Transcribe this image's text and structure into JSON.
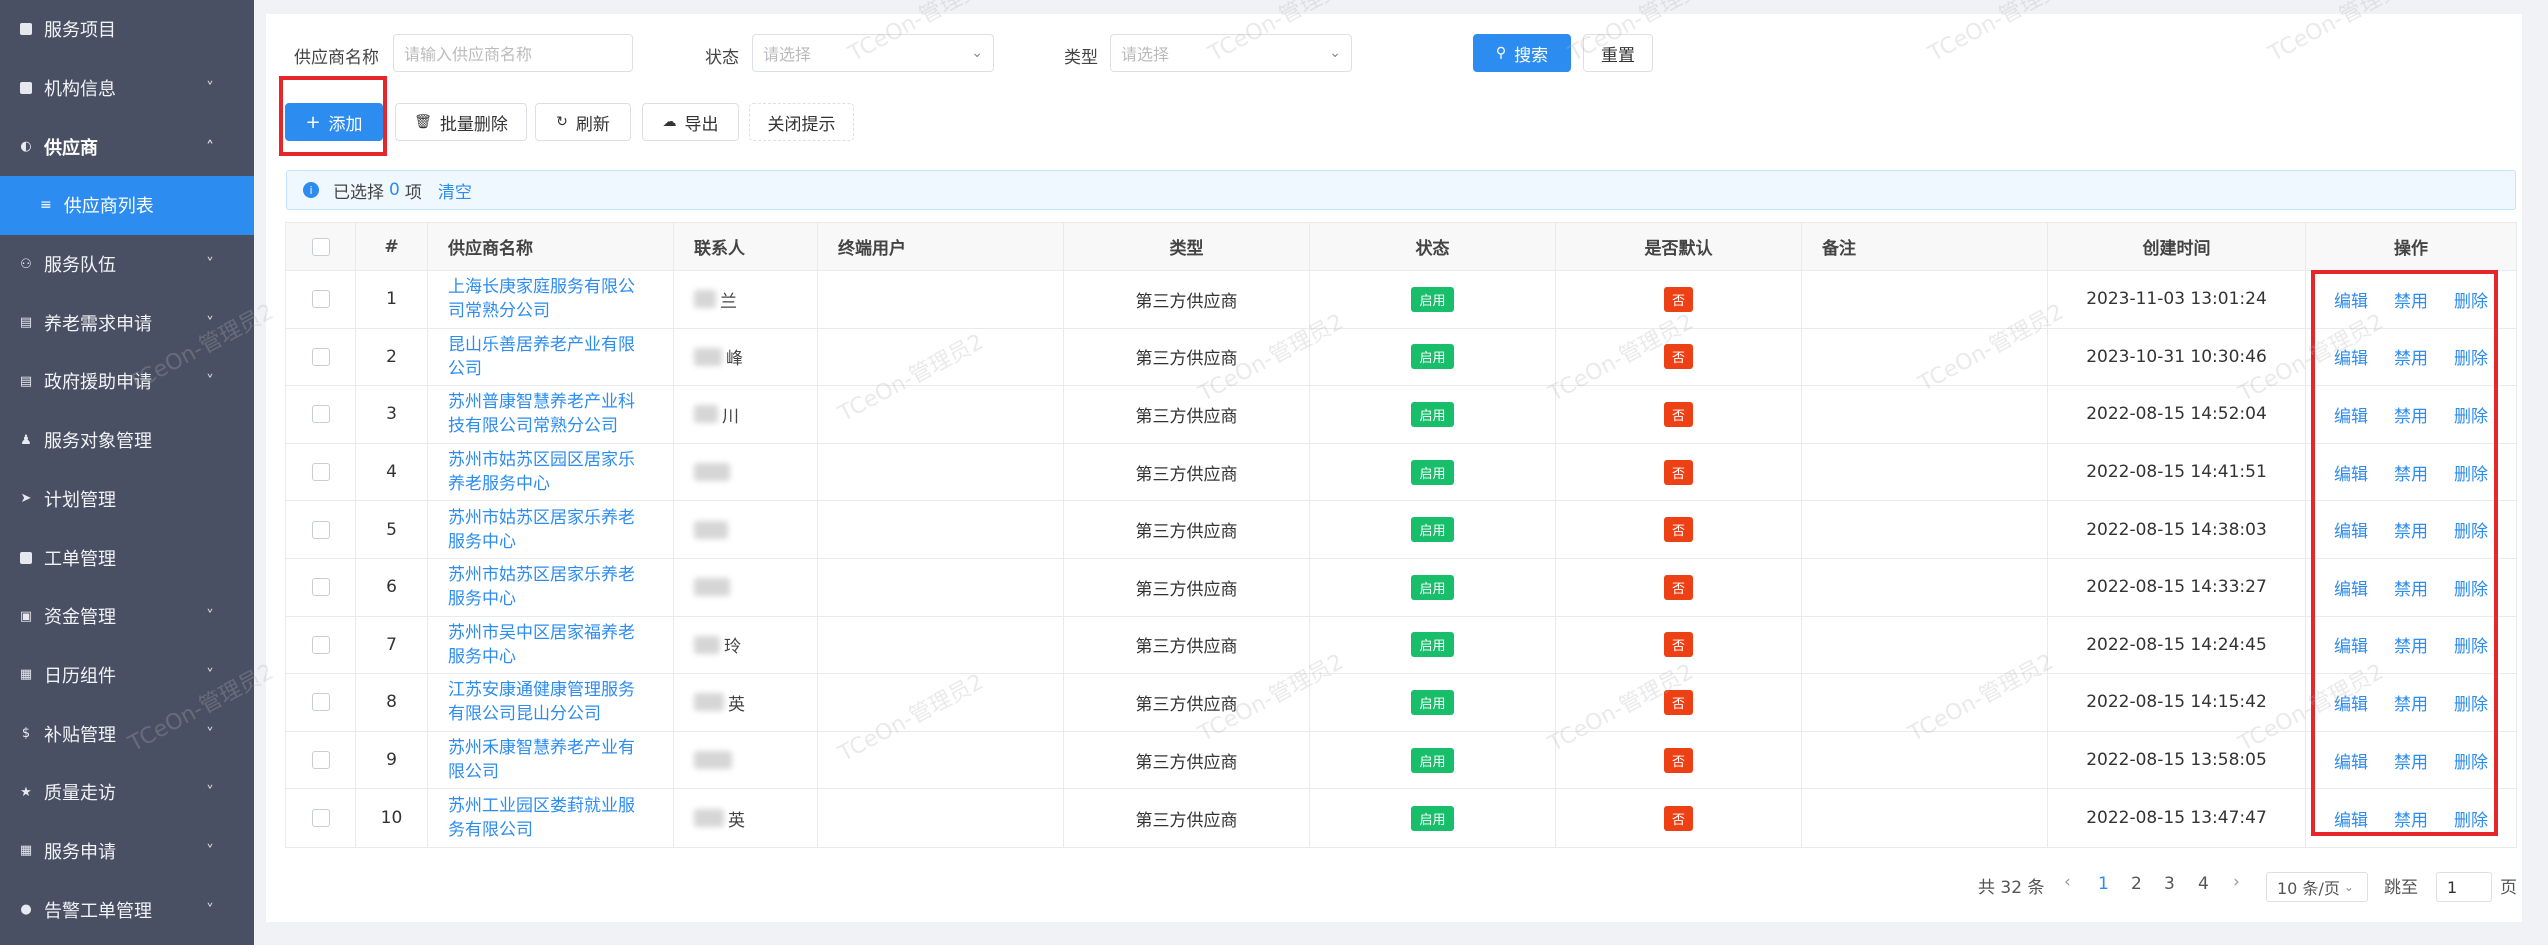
{
  "sidebar": {
    "items": [
      {
        "label": "服务项目",
        "icon": "box-icon",
        "chevron": false
      },
      {
        "label": "机构信息",
        "icon": "box-icon",
        "chevron": true
      },
      {
        "label": "供应商",
        "icon": "globe-icon",
        "chevron": true,
        "expanded": true
      },
      {
        "label": "供应商列表",
        "sub": true
      },
      {
        "label": "服务队伍",
        "icon": "team-icon",
        "chevron": true
      },
      {
        "label": "养老需求申请",
        "icon": "doc-icon",
        "chevron": true
      },
      {
        "label": "政府援助申请",
        "icon": "doc-icon",
        "chevron": true
      },
      {
        "label": "服务对象管理",
        "icon": "person-icon",
        "chevron": false
      },
      {
        "label": "计划管理",
        "icon": "send-icon",
        "chevron": false
      },
      {
        "label": "工单管理",
        "icon": "box-icon",
        "chevron": false
      },
      {
        "label": "资金管理",
        "icon": "money-icon",
        "chevron": true
      },
      {
        "label": "日历组件",
        "icon": "calendar-icon",
        "chevron": true
      },
      {
        "label": "补贴管理",
        "icon": "dollar-icon",
        "chevron": true
      },
      {
        "label": "质量走访",
        "icon": "walk-icon",
        "chevron": true
      },
      {
        "label": "服务申请",
        "icon": "calendar-icon",
        "chevron": true
      },
      {
        "label": "告警工单管理",
        "icon": "alert-icon",
        "chevron": true
      }
    ]
  },
  "filters": {
    "supplier_label": "供应商名称",
    "supplier_placeholder": "请输入供应商名称",
    "status_label": "状态",
    "status_placeholder": "请选择",
    "type_label": "类型",
    "type_placeholder": "请选择",
    "search_button": "搜索",
    "reset_button": "重置"
  },
  "toolbar": {
    "add": "添加",
    "batch_delete": "批量删除",
    "refresh": "刷新",
    "export": "导出",
    "close_tip": "关闭提示"
  },
  "alert": {
    "prefix": "已选择",
    "count": "0",
    "suffix": "项",
    "clear": "清空"
  },
  "table": {
    "headers": {
      "index": "#",
      "name": "供应商名称",
      "contact": "联系人",
      "end_user": "终端用户",
      "type": "类型",
      "status": "状态",
      "default": "是否默认",
      "note": "备注",
      "created": "创建时间",
      "ops": "操作"
    },
    "rows": [
      {
        "index": "1",
        "name": "上海长庚家庭服务有限公司常熟分公司",
        "contact_suffix": "兰",
        "type": "第三方供应商",
        "status": "启用",
        "default": "否",
        "created": "2023-11-03 13:01:24"
      },
      {
        "index": "2",
        "name": "昆山乐善居养老产业有限公司",
        "contact_suffix": "峰",
        "type": "第三方供应商",
        "status": "启用",
        "default": "否",
        "created": "2023-10-31 10:30:46"
      },
      {
        "index": "3",
        "name": "苏州普康智慧养老产业科技有限公司常熟分公司",
        "contact_suffix": "川",
        "type": "第三方供应商",
        "status": "启用",
        "default": "否",
        "created": "2022-08-15 14:52:04"
      },
      {
        "index": "4",
        "name": "苏州市姑苏区园区居家乐养老服务中心",
        "contact_suffix": "",
        "type": "第三方供应商",
        "status": "启用",
        "default": "否",
        "created": "2022-08-15 14:41:51"
      },
      {
        "index": "5",
        "name": "苏州市姑苏区居家乐养老服务中心",
        "contact_suffix": "",
        "type": "第三方供应商",
        "status": "启用",
        "default": "否",
        "created": "2022-08-15 14:38:03"
      },
      {
        "index": "6",
        "name": "苏州市姑苏区居家乐养老服务中心",
        "contact_suffix": "",
        "type": "第三方供应商",
        "status": "启用",
        "default": "否",
        "created": "2022-08-15 14:33:27"
      },
      {
        "index": "7",
        "name": "苏州市吴中区居家福养老服务中心",
        "contact_suffix": "玲",
        "type": "第三方供应商",
        "status": "启用",
        "default": "否",
        "created": "2022-08-15 14:24:45"
      },
      {
        "index": "8",
        "name": "江苏安康通健康管理服务有限公司昆山分公司",
        "contact_suffix": "英",
        "type": "第三方供应商",
        "status": "启用",
        "default": "否",
        "created": "2022-08-15 14:15:42"
      },
      {
        "index": "9",
        "name": "苏州禾康智慧养老产业有限公司",
        "contact_suffix": "",
        "type": "第三方供应商",
        "status": "启用",
        "default": "否",
        "created": "2022-08-15 13:58:05"
      },
      {
        "index": "10",
        "name": "苏州工业园区娄葑就业服务有限公司",
        "contact_suffix": "英",
        "type": "第三方供应商",
        "status": "启用",
        "default": "否",
        "created": "2022-08-15 13:47:47"
      }
    ],
    "ops": {
      "edit": "编辑",
      "disable": "禁用",
      "delete": "删除"
    }
  },
  "pagination": {
    "total_text": "共 32 条",
    "pages": [
      "1",
      "2",
      "3",
      "4"
    ],
    "current": "1",
    "page_size": "10 条/页",
    "jump_label": "跳至",
    "jump_value": "1",
    "page_unit": "页"
  },
  "watermark": "TCeOn-管理员2",
  "colors": {
    "primary": "#2d8cf0",
    "sidebar": "#4a5064",
    "success": "#19be6b",
    "danger": "#ed4014",
    "highlight": "#e5262b"
  }
}
